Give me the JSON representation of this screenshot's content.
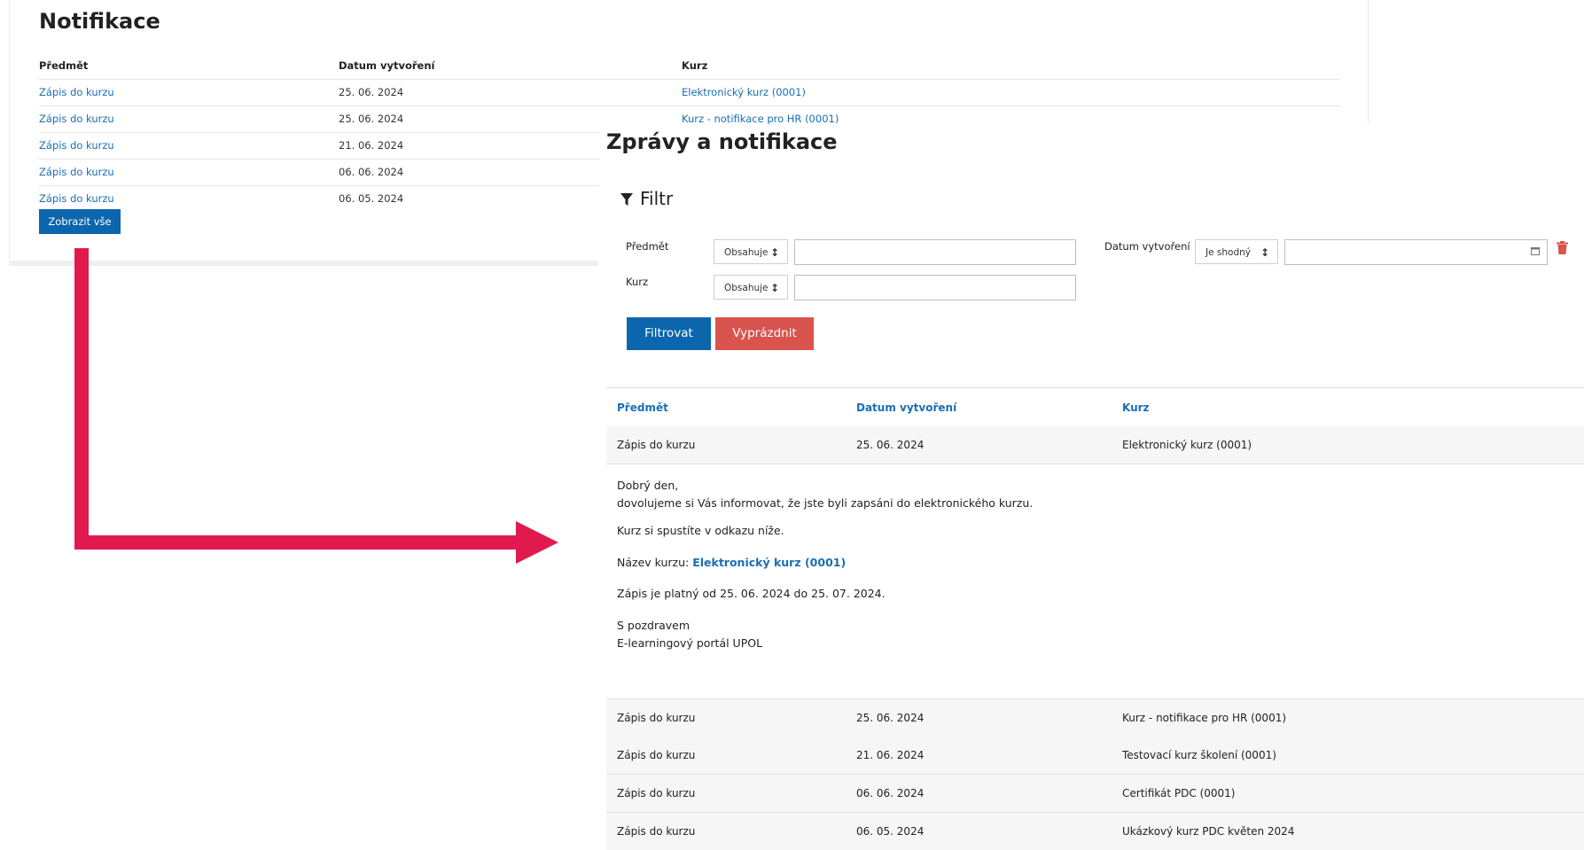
{
  "widget": {
    "title": "Notifikace",
    "columns": [
      "Předmět",
      "Datum vytvoření",
      "Kurz"
    ],
    "rows": [
      {
        "subject": "Zápis do kurzu",
        "date": "25. 06. 2024",
        "course": "Elektronický kurz (0001)"
      },
      {
        "subject": "Zápis do kurzu",
        "date": "25. 06. 2024",
        "course": "Kurz - notifikace pro HR (0001)"
      },
      {
        "subject": "Zápis do kurzu",
        "date": "21. 06. 2024",
        "course": ""
      },
      {
        "subject": "Zápis do kurzu",
        "date": "06. 06. 2024",
        "course": ""
      },
      {
        "subject": "Zápis do kurzu",
        "date": "06. 05. 2024",
        "course": ""
      }
    ],
    "show_all_label": "Zobrazit vše"
  },
  "panel": {
    "title": "Zprávy a notifikace",
    "filter": {
      "heading": "Filtr",
      "subject_label": "Předmět",
      "subject_op": "Obsahuje",
      "course_label": "Kurz",
      "course_op": "Obsahuje",
      "date_label": "Datum vytvoření",
      "date_op": "Je shodný",
      "filter_button": "Filtrovat",
      "clear_button": "Vyprázdnit"
    },
    "columns": [
      "Předmět",
      "Datum vytvoření",
      "Kurz"
    ],
    "rows": [
      {
        "subject": "Zápis do kurzu",
        "date": "25. 06. 2024",
        "course": "Elektronický kurz (0001)"
      },
      {
        "subject": "Zápis do kurzu",
        "date": "25. 06. 2024",
        "course": "Kurz - notifikace pro HR (0001)"
      },
      {
        "subject": "Zápis do kurzu",
        "date": "21. 06. 2024",
        "course": "Testovací kurz školení (0001)"
      },
      {
        "subject": "Zápis do kurzu",
        "date": "06. 06. 2024",
        "course": "Certifikát PDC (0001)"
      },
      {
        "subject": "Zápis do kurzu",
        "date": "06. 05. 2024",
        "course": "Ukázkový kurz PDC květen 2024"
      }
    ],
    "detail": {
      "greeting": "Dobrý den,",
      "line1": "dovolujeme si Vás informovat, že jste byli zapsáni do elektronického kurzu.",
      "line2": "Kurz si spustíte v odkazu níže.",
      "course_name_label": "Název kurzu: ",
      "course_name_link": "Elektronický kurz (0001)",
      "validity": "Zápis je platný od 25. 06. 2024 do 25. 07. 2024.",
      "closing": "S pozdravem",
      "signature": "E-learningový portál UPOL"
    }
  },
  "colors": {
    "primary": "#0b66ad",
    "danger": "#d9534f",
    "link": "#1a6fb3",
    "arrow": "#e01a4f"
  }
}
